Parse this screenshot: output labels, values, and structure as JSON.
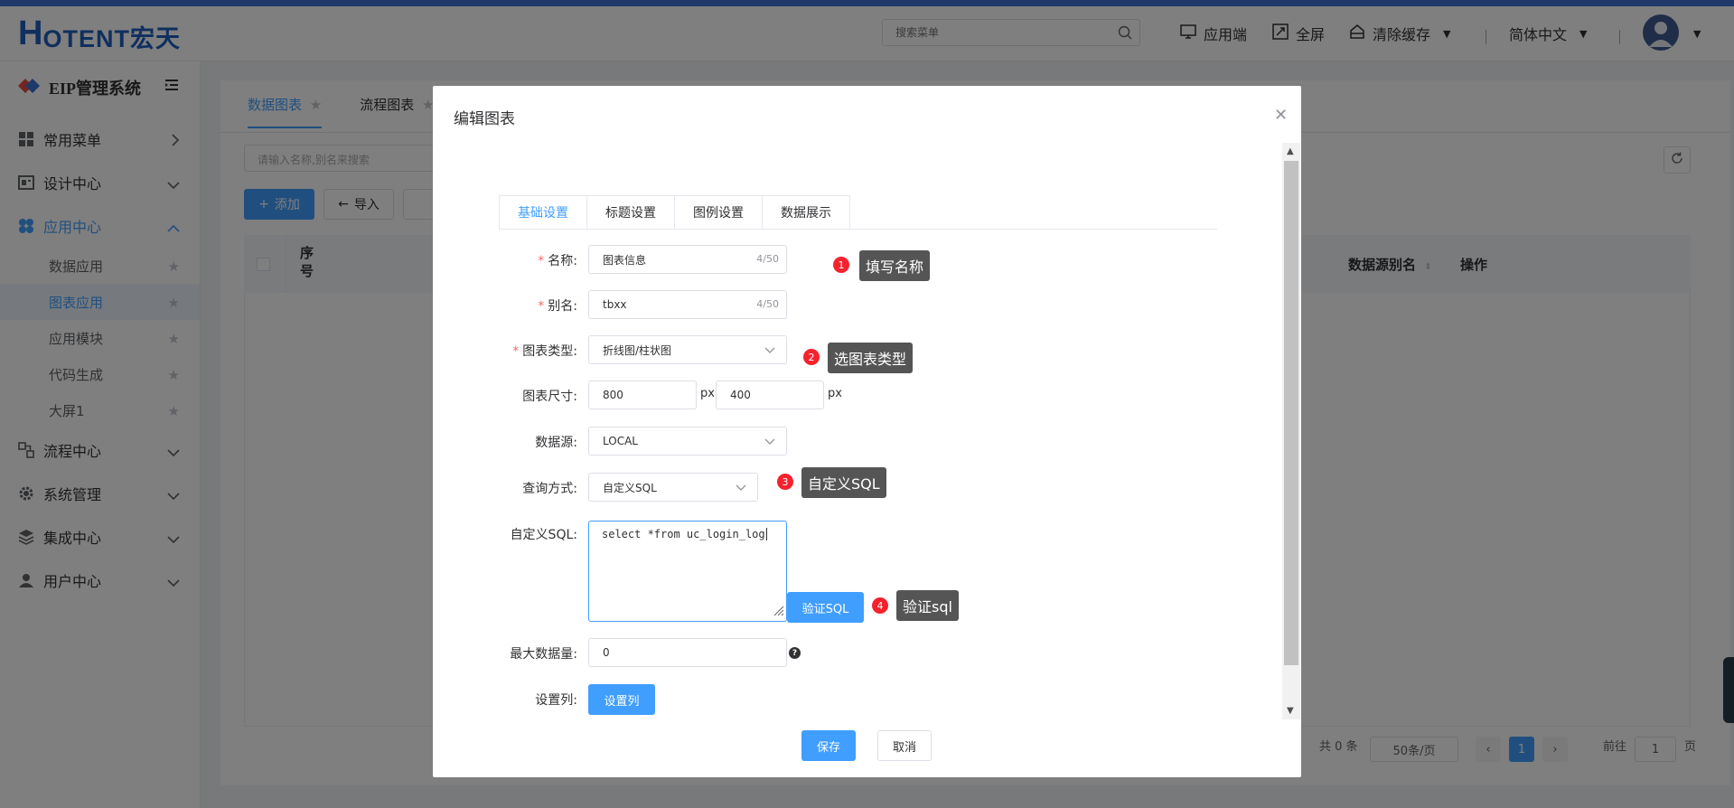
{
  "header": {
    "logo_big": "H",
    "logo_rest": "OTENT宏天",
    "search_placeholder": "搜索菜单",
    "app_end": "应用端",
    "fullscreen": "全屏",
    "clear_cache": "清除缓存",
    "language": "简体中文"
  },
  "sidebar": {
    "system_name": "EIP管理系统",
    "menu": [
      {
        "label": "常用菜单"
      },
      {
        "label": "设计中心"
      },
      {
        "label": "应用中心"
      },
      {
        "label": "流程中心"
      },
      {
        "label": "系统管理"
      },
      {
        "label": "集成中心"
      },
      {
        "label": "用户中心"
      }
    ],
    "app_sub": [
      {
        "label": "数据应用"
      },
      {
        "label": "图表应用"
      },
      {
        "label": "应用模块"
      },
      {
        "label": "代码生成"
      },
      {
        "label": "大屏1"
      }
    ]
  },
  "main": {
    "tabs": [
      {
        "label": "数据图表"
      },
      {
        "label": "流程图表"
      }
    ],
    "search_placeholder": "请输入名称,别名来搜索",
    "add_label": "添加",
    "import_label": "导入",
    "columns": {
      "index": "序号",
      "datasource_alias": "数据源别名",
      "action": "操作"
    },
    "pager": {
      "total": "共 0 条",
      "page_size": "50条/页",
      "current_page": "1",
      "goto_prefix": "前往",
      "goto_value": "1",
      "goto_suffix": "页"
    }
  },
  "dialog": {
    "title": "编辑图表",
    "tabs": [
      {
        "label": "基础设置"
      },
      {
        "label": "标题设置"
      },
      {
        "label": "图例设置"
      },
      {
        "label": "数据展示"
      }
    ],
    "fields": {
      "name_label": "名称:",
      "name_value": "图表信息",
      "name_count": "4/50",
      "alias_label": "别名:",
      "alias_value": "tbxx",
      "alias_count": "4/50",
      "type_label": "图表类型:",
      "type_value": "折线图/柱状图",
      "size_label": "图表尺寸:",
      "width_value": "800",
      "height_value": "400",
      "px_unit": "px",
      "datasource_label": "数据源:",
      "datasource_value": "LOCAL",
      "query_label": "查询方式:",
      "query_value": "自定义SQL",
      "sql_label": "自定义SQL:",
      "sql_value": "select *from uc_login_log",
      "verify_sql_button": "验证SQL",
      "max_label": "最大数据量:",
      "max_value": "0",
      "help_mark": "?",
      "columns_label": "设置列:",
      "columns_button": "设置列"
    },
    "save_button": "保存",
    "cancel_button": "取消"
  },
  "annotations": [
    {
      "number": "1",
      "text": "填写名称"
    },
    {
      "number": "2",
      "text": "选图表类型"
    },
    {
      "number": "3",
      "text": "自定义SQL"
    },
    {
      "number": "4",
      "text": "验证sql"
    }
  ],
  "colors": {
    "primary": "#409eff",
    "brand": "#1f5fbf",
    "badge": "#f5222d",
    "tooltip": "#555555"
  }
}
